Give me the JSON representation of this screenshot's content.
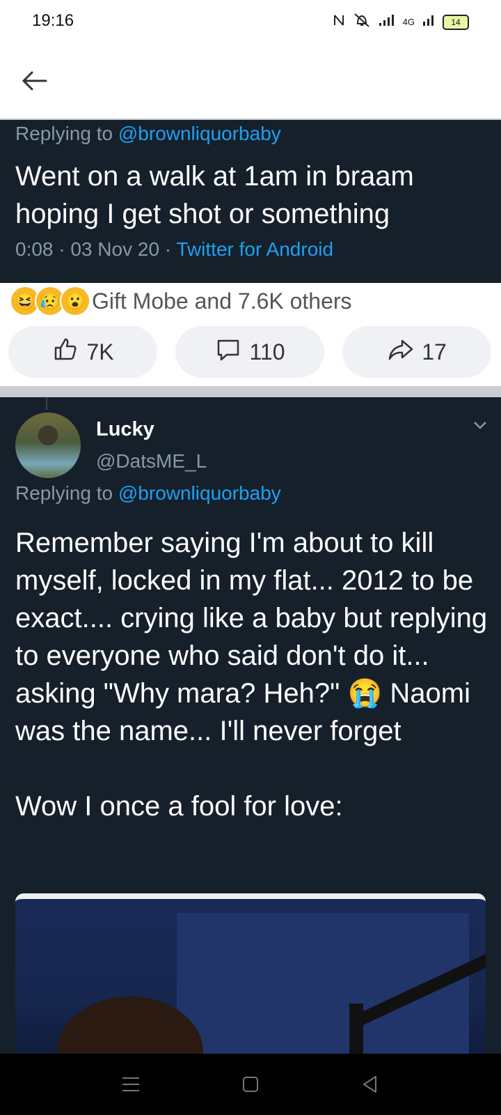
{
  "status_bar": {
    "time": "19:16",
    "network": "4G",
    "battery": "14"
  },
  "tweet_top": {
    "replying_prefix": "Replying to ",
    "replying_handle": "@brownliquorbaby",
    "text": "Went on a walk at 1am in braam hoping I get shot or something",
    "time": "0:08 · 03 Nov 20 · ",
    "client": "Twitter for Android"
  },
  "reactions": {
    "emojis": [
      "😆",
      "😥",
      "😮"
    ],
    "summary": "Gift Mobe and 7.6K others"
  },
  "actions": {
    "like_count": "7K",
    "comment_count": "110",
    "share_count": "17"
  },
  "tweet_bottom": {
    "user_name": "Lucky",
    "user_handle": "@DatsME_L",
    "replying_prefix": "Replying to ",
    "replying_handle": "@brownliquorbaby",
    "text": "Remember saying I'm about to kill myself, locked in my flat... 2012 to be exact.... crying like a baby but replying to everyone who said don't do it... asking \"Why mara? Heh?\" 😭 Naomi was the name... I'll never forget\n\nWow I once a fool for love:"
  },
  "colors": {
    "twitter_dark_bg": "#15202b",
    "twitter_blue": "#1da1f2",
    "muted_text": "#8899a6",
    "action_btn_bg": "#eff1f4"
  }
}
